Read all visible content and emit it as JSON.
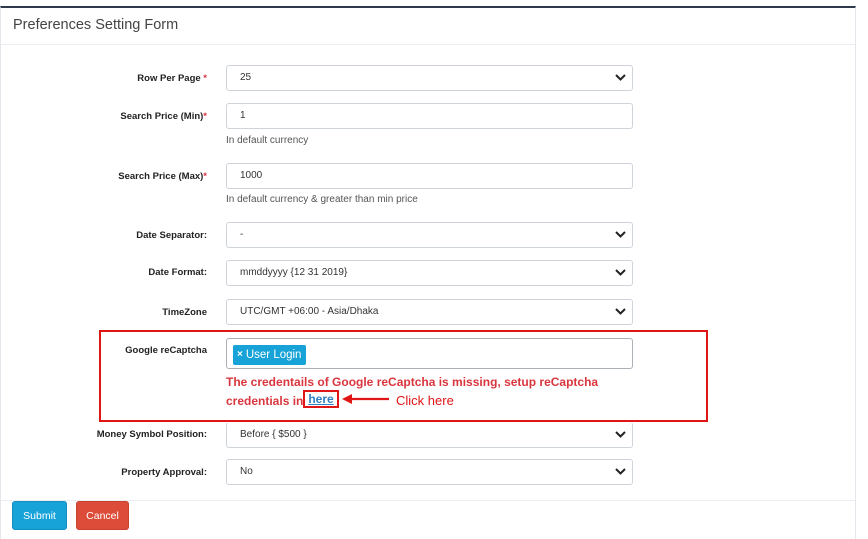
{
  "card": {
    "title": "Preferences Setting Form"
  },
  "fields": {
    "row_per_page": {
      "label": "Row Per Page",
      "required": "*",
      "value": "25"
    },
    "search_min": {
      "label": "Search Price (Min)",
      "required": "*",
      "value": "1",
      "help": "In default currency"
    },
    "search_max": {
      "label": "Search Price (Max)",
      "required": "*",
      "value": "1000",
      "help": "In default currency & greater than min price"
    },
    "date_separator": {
      "label": "Date Separator:",
      "value": "-"
    },
    "date_format": {
      "label": "Date Format:",
      "value": "mmddyyyy {12 31 2019}"
    },
    "timezone": {
      "label": "TimeZone",
      "value": "UTC/GMT +06:00 - Asia/Dhaka"
    },
    "recaptcha": {
      "label": "Google reCaptcha",
      "tag": "User Login",
      "tag_remove": "×",
      "error": "The credentails of Google reCaptcha is missing, setup reCaptcha credentials in",
      "link": "here"
    },
    "money_symbol": {
      "label": "Money Symbol Position:",
      "value": "Before { $500 }"
    },
    "property_approval": {
      "label": "Property Approval:",
      "value": "No"
    }
  },
  "annotation": {
    "text": "Click here",
    "color": "#e01616"
  },
  "buttons": {
    "submit": "Submit",
    "cancel": "Cancel"
  },
  "colors": {
    "primary": "#17a2d8",
    "danger": "#dd4b39",
    "error_text": "#d9363e"
  }
}
